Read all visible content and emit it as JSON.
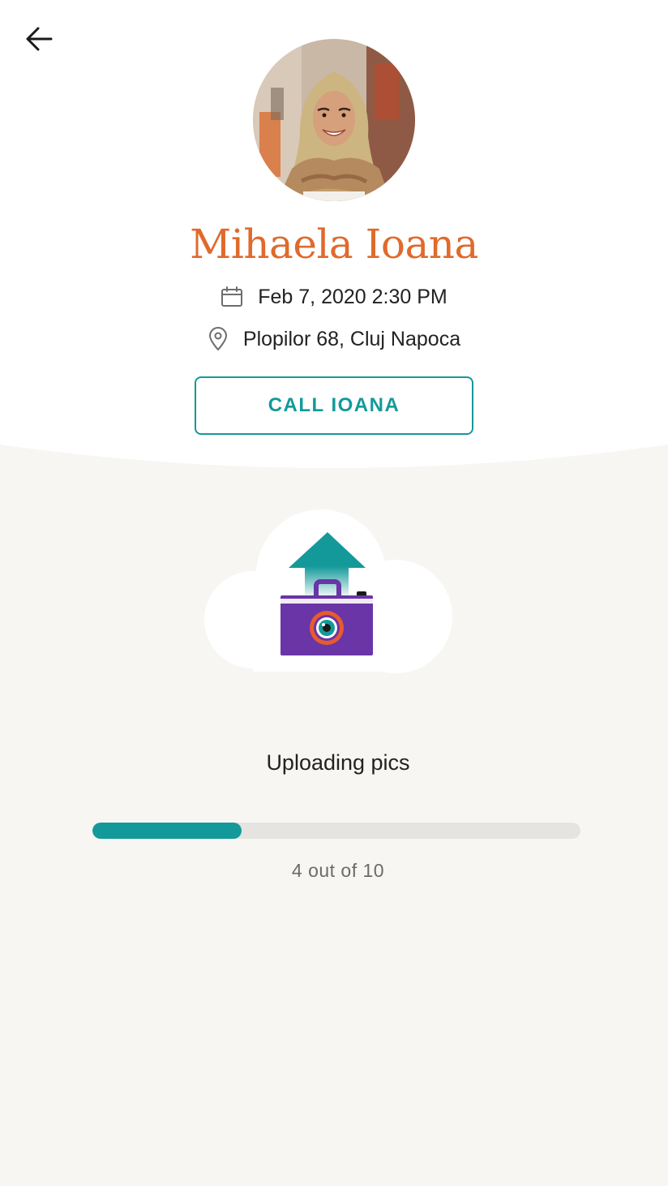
{
  "colors": {
    "accent": "#14999a",
    "name": "#e06a2c",
    "camera": "#6a35a7",
    "lens_ring": "#e85b2c",
    "track": "#e5e4e1"
  },
  "icons": {
    "back": "arrow-left-icon",
    "date": "calendar-icon",
    "address": "location-pin-icon",
    "illustration": "cloud-upload-camera-icon"
  },
  "profile": {
    "name": "Mihaela Ioana",
    "date": "Feb 7, 2020 2:30 PM",
    "address": "Plopilor 68, Cluj Napoca",
    "call_label": "CALL IOANA"
  },
  "upload": {
    "title": "Uploading pics",
    "current": 4,
    "total": 10,
    "progress_text": "4 out of 10",
    "progress_fraction": 0.305
  }
}
